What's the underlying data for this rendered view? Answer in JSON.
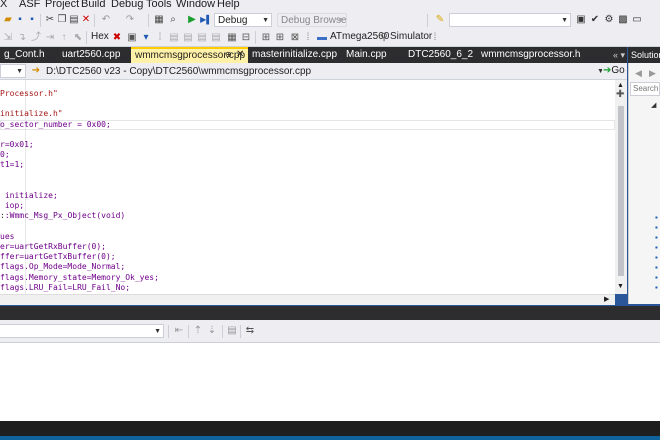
{
  "menu": [
    "X",
    "ASF",
    "Project",
    "Build",
    "Debug",
    "Tools",
    "Window",
    "Help"
  ],
  "toolbar": {
    "config_value": "Debug",
    "debug_browser": "Debug Browser",
    "hex_label": "Hex",
    "device_label": "ATmega2560",
    "simulator_label": "Simulator"
  },
  "tabs": [
    {
      "label": "g_Cont.h",
      "active": false
    },
    {
      "label": "uart2560.cpp",
      "active": false
    },
    {
      "label": "wmmcmsgprocessor.cpp",
      "active": true
    },
    {
      "label": "masterinitialize.cpp",
      "active": false
    },
    {
      "label": "Main.cpp",
      "active": false
    },
    {
      "label": "DTC2560_6_2",
      "active": false
    },
    {
      "label": "wmmcmsgprocessor.h",
      "active": false
    }
  ],
  "navbar": {
    "path": "D:\\DTC2560 v23 - Copy\\DTC2560\\wmmcmsgprocessor.cpp",
    "go_label": "Go"
  },
  "code_lines": [
    {
      "segments": [
        {
          "t": "Processor.h\"",
          "c": "c-str"
        }
      ]
    },
    {
      "segments": []
    },
    {
      "segments": [
        {
          "t": "initialize.h\"",
          "c": "c-str"
        }
      ]
    },
    {
      "segments": [
        {
          "t": "o_sector_number = 0x00;",
          "c": "c-fn"
        }
      ]
    },
    {
      "segments": []
    },
    {
      "segments": [
        {
          "t": "r=0x01;",
          "c": "c-fn"
        }
      ]
    },
    {
      "segments": [
        {
          "t": "0;",
          "c": "c-fn"
        }
      ]
    },
    {
      "segments": [
        {
          "t": "t1=1;",
          "c": "c-fn"
        }
      ]
    },
    {
      "segments": []
    },
    {
      "segments": []
    },
    {
      "segments": [
        {
          "t": " initialize;",
          "c": "c-fn"
        }
      ]
    },
    {
      "segments": [
        {
          "t": " iop;",
          "c": "c-fn"
        }
      ]
    },
    {
      "segments": [
        {
          "t": ":",
          "c": "c-txt"
        },
        {
          "t": ":Wmmc_Msg_Px_Object(void)",
          "c": "c-fn"
        }
      ]
    },
    {
      "segments": []
    },
    {
      "segments": [
        {
          "t": "ues",
          "c": "c-fn"
        }
      ]
    },
    {
      "segments": [
        {
          "t": "er=uartGetRxBuffer(0);",
          "c": "c-fn"
        }
      ]
    },
    {
      "segments": [
        {
          "t": "ffer=uartGetTxBuffer(0);",
          "c": "c-fn"
        }
      ]
    },
    {
      "segments": [
        {
          "t": "flags.Op_Mode=Mode_Normal;",
          "c": "c-fn"
        }
      ]
    },
    {
      "segments": [
        {
          "t": "flags.Memory_state=Memory_Ok_yes;",
          "c": "c-fn"
        }
      ]
    },
    {
      "segments": [
        {
          "t": "flags.LRU_Fail=LRU_Fail_No;",
          "c": "c-fn"
        }
      ]
    }
  ],
  "solution": {
    "title": "Solution",
    "search_placeholder": "Search S"
  },
  "colors": {
    "accent": "#007acc",
    "tab_active": "#fff1a8",
    "chrome": "#eeeef2",
    "dark": "#2d2d30"
  }
}
